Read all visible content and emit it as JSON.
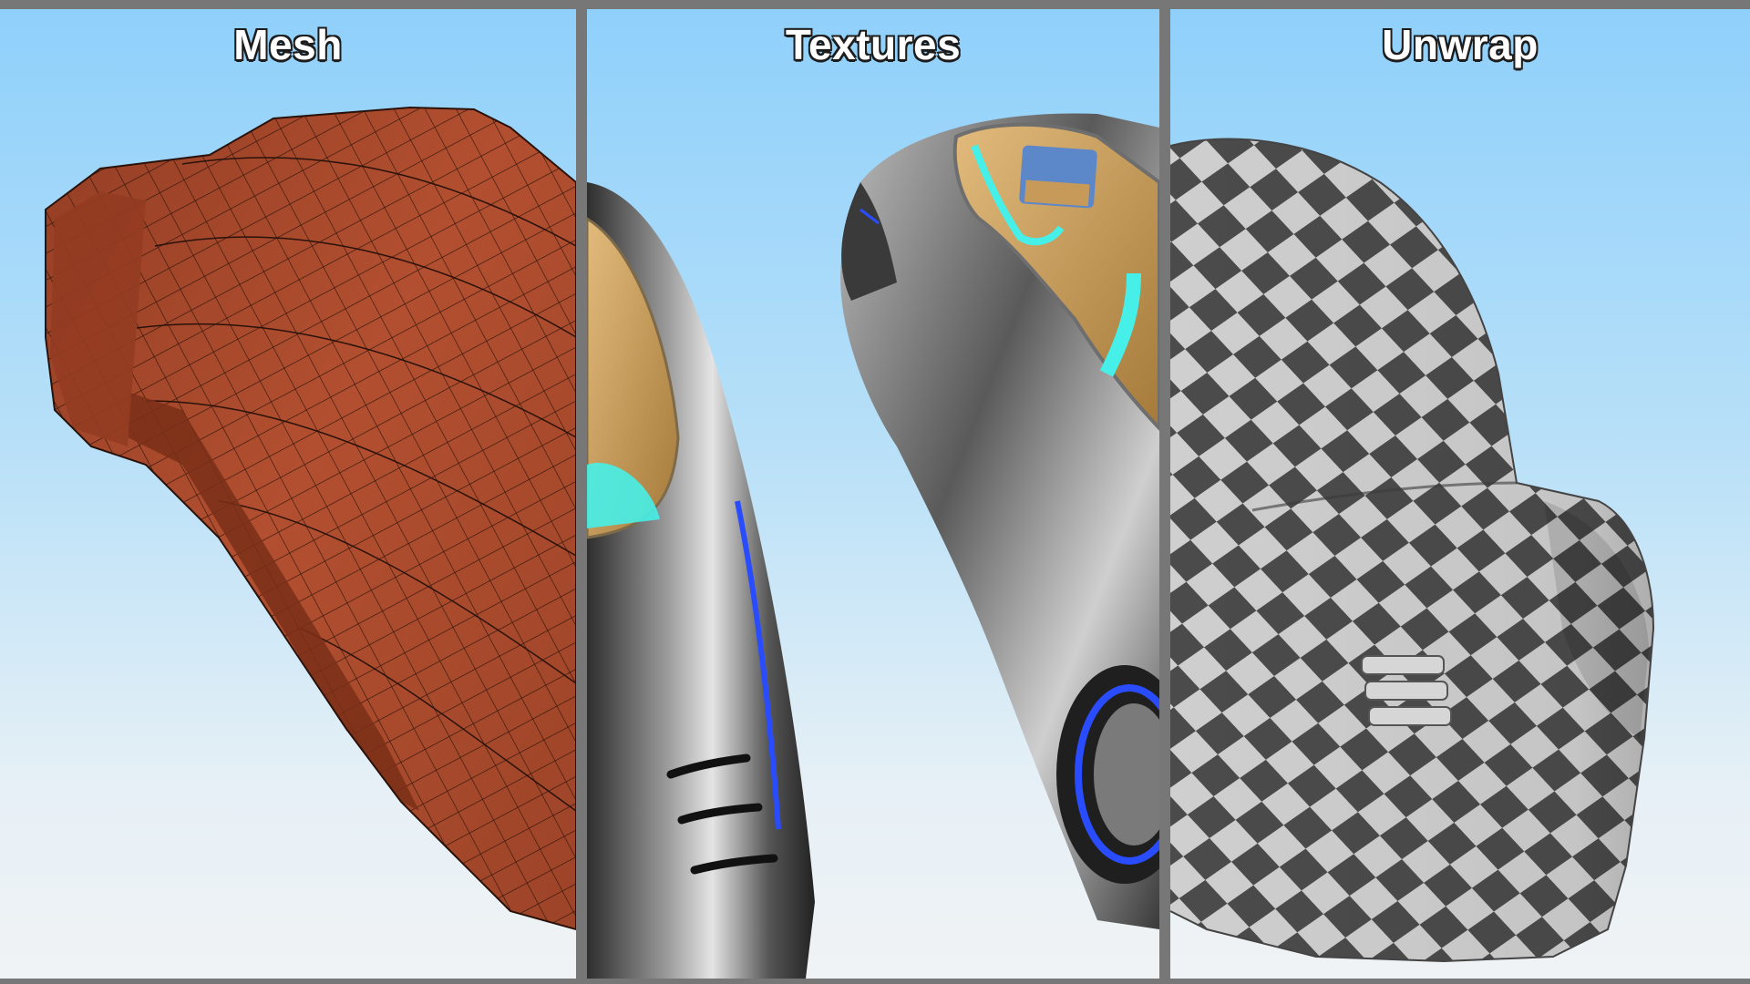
{
  "panels": [
    {
      "title": "Mesh"
    },
    {
      "title": "Textures"
    },
    {
      "title": "Unwrap"
    }
  ],
  "colors": {
    "background_frame": "#777777",
    "sky_top": "#8fd0fb",
    "sky_bottom": "#f0f3f5",
    "mesh_fill": "#b24f30",
    "mesh_wire": "#2a120a",
    "chrome_dark": "#3a3a3a",
    "chrome_light": "#d9d9d9",
    "interior_tan": "#c99a55",
    "accent_cyan": "#46f0e8",
    "accent_blue": "#2a4cff",
    "checker_dark": "#4b4b4b",
    "checker_light": "#cfcfcf"
  }
}
